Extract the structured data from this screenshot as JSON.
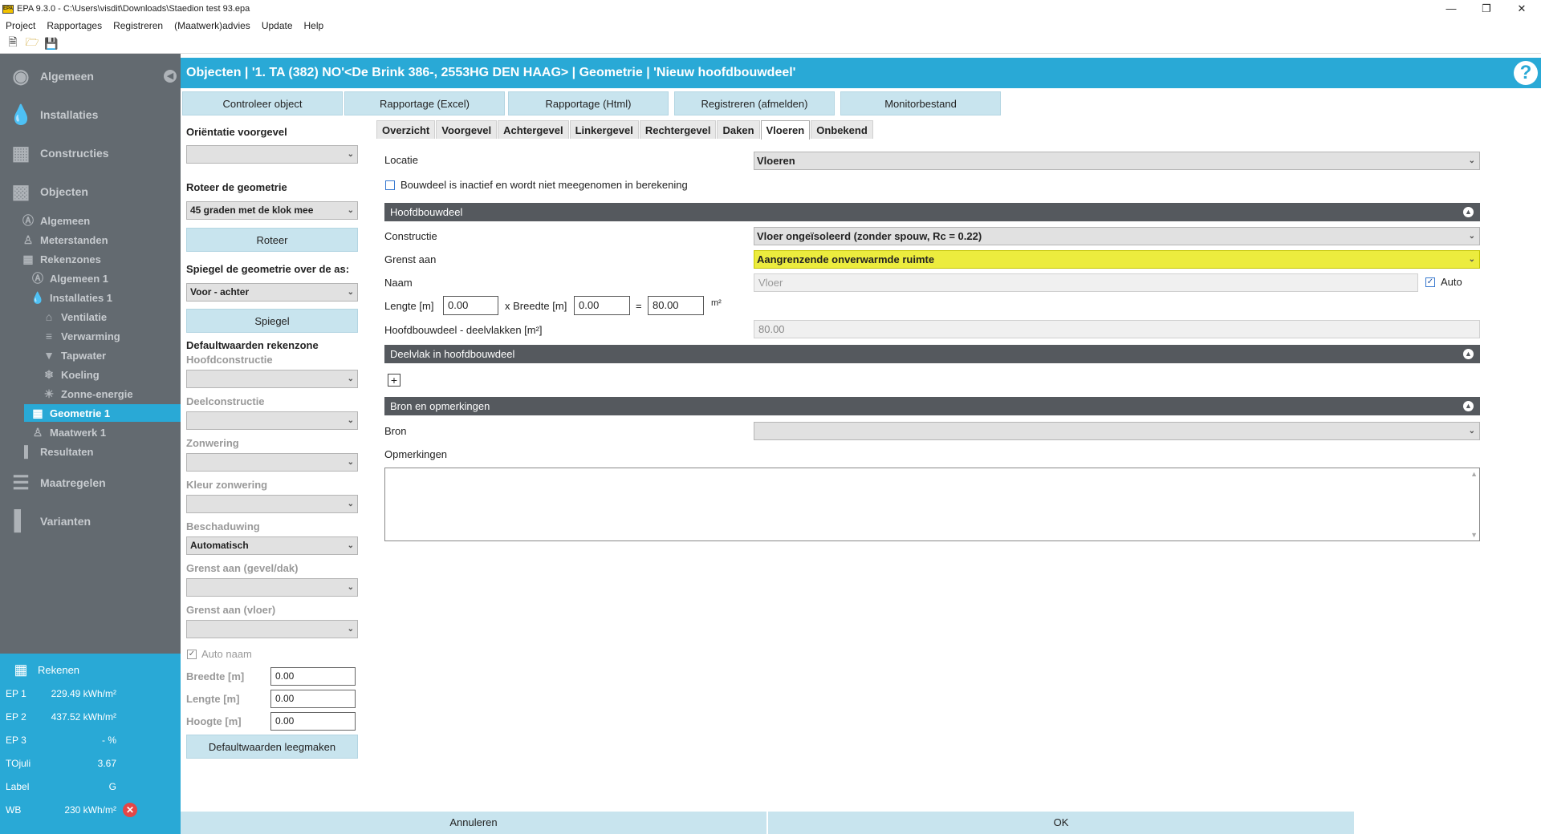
{
  "window": {
    "title": "EPA 9.3.0 - C:\\Users\\visdit\\Downloads\\Staedion test 93.epa",
    "app_icon": "EPA"
  },
  "menu": [
    "Project",
    "Rapportages",
    "Registreren",
    "(Maatwerk)advies",
    "Update",
    "Help"
  ],
  "sidebar": {
    "main": [
      {
        "label": "Algemeen",
        "icon": "flame-circle-icon"
      },
      {
        "label": "Installaties",
        "icon": "flame-icon"
      },
      {
        "label": "Constructies",
        "icon": "blocks-icon"
      },
      {
        "label": "Objecten",
        "icon": "building-icon"
      }
    ],
    "sub": [
      {
        "label": "Algemeen",
        "icon": "letter-a-icon"
      },
      {
        "label": "Meterstanden",
        "icon": "person-icon"
      },
      {
        "label": "Rekenzones",
        "icon": "grid-icon"
      },
      {
        "label": "Algemeen 1",
        "icon": "letter-a-icon"
      },
      {
        "label": "Installaties 1",
        "icon": "flame-icon"
      },
      {
        "label": "Ventilatie",
        "icon": "vent-icon"
      },
      {
        "label": "Verwarming",
        "icon": "thermometer-icon"
      },
      {
        "label": "Tapwater",
        "icon": "drop-icon"
      },
      {
        "label": "Koeling",
        "icon": "snowflake-icon"
      },
      {
        "label": "Zonne-energie",
        "icon": "sun-icon"
      },
      {
        "label": "Geometrie 1",
        "icon": "grid-icon"
      },
      {
        "label": "Maatwerk 1",
        "icon": "person-icon"
      },
      {
        "label": "Resultaten",
        "icon": "bar-chart-icon"
      }
    ],
    "extra": [
      {
        "label": "Maatregelen",
        "icon": "list-icon"
      },
      {
        "label": "Varianten",
        "icon": "bar-chart-icon"
      }
    ]
  },
  "calc": {
    "title": "Rekenen",
    "rows": [
      {
        "label": "EP 1",
        "value": "229.49 kWh/m²"
      },
      {
        "label": "EP 2",
        "value": "437.52 kWh/m²"
      },
      {
        "label": "EP 3",
        "value": "-  %"
      },
      {
        "label": "TOjuli",
        "value": "3.67"
      },
      {
        "label": "Label",
        "value": "G"
      },
      {
        "label": "WB",
        "value": "230 kWh/m²"
      }
    ]
  },
  "header": {
    "title": "Objecten | '1. TA (382) NO'<De Brink 386-, 2553HG DEN HAAG> | Geometrie | 'Nieuw hoofdbouwdeel'",
    "help": "?"
  },
  "top_buttons": [
    "Controleer object",
    "Rapportage (Excel)",
    "Rapportage (Html)",
    "Registreren (afmelden)",
    "Monitorbestand"
  ],
  "left": {
    "orientatie_label": "Oriëntatie voorgevel",
    "orientatie_value": "",
    "roteer_label": "Roteer de geometrie",
    "roteer_value": "45 graden met de klok mee",
    "roteer_btn": "Roteer",
    "spiegel_label": "Spiegel de geometrie over de as:",
    "spiegel_value": "Voor - achter",
    "spiegel_btn": "Spiegel",
    "default_label": "Defaultwaarden rekenzone",
    "hoofdconstructie": "Hoofdconstructie",
    "deelconstructie": "Deelconstructie",
    "zonwering": "Zonwering",
    "kleur_zonwering": "Kleur zonwering",
    "beschaduwing": "Beschaduwing",
    "beschaduwing_value": "Automatisch",
    "grenst_gevel": "Grenst aan (gevel/dak)",
    "grenst_vloer": "Grenst aan (vloer)",
    "auto_naam": "Auto naam",
    "breedte_label": "Breedte [m]",
    "breedte_value": "0.00",
    "lengte_label": "Lengte [m]",
    "lengte_value": "0.00",
    "hoogte_label": "Hoogte [m]",
    "hoogte_value": "0.00",
    "leegmaken_btn": "Defaultwaarden leegmaken"
  },
  "tabs": [
    "Overzicht",
    "Voorgevel",
    "Achtergevel",
    "Linkergevel",
    "Rechtergevel",
    "Daken",
    "Vloeren",
    "Onbekend"
  ],
  "active_tab": "Vloeren",
  "form": {
    "locatie_label": "Locatie",
    "locatie_value": "Vloeren",
    "inactief_label": "Bouwdeel is inactief en wordt niet meegenomen in berekening",
    "section_hoofd": "Hoofdbouwdeel",
    "constructie_label": "Constructie",
    "constructie_value": "Vloer ongeïsoleerd (zonder spouw, Rc = 0.22)",
    "grenst_label": "Grenst aan",
    "grenst_value": "Aangrenzende onverwarmde ruimte",
    "naam_label": "Naam",
    "naam_placeholder": "Vloer",
    "auto_label": "Auto",
    "lengte_label": "Lengte [m]",
    "lengte_value": "0.00",
    "breedte_label": "x Breedte [m]",
    "breedte_value": "0.00",
    "eq": "=",
    "area_value": "80.00",
    "area_unit": "m²",
    "deelvlak_label": "Hoofdbouwdeel - deelvlakken [m²]",
    "deelvlak_value": "80.00",
    "section_deel": "Deelvlak in hoofdbouwdeel",
    "add_symbol": "+",
    "section_bron": "Bron en opmerkingen",
    "bron_label": "Bron",
    "opmerkingen_label": "Opmerkingen"
  },
  "bottom": {
    "cancel": "Annuleren",
    "ok": "OK"
  },
  "colors": {
    "accent": "#29a9d6",
    "sidebar": "#636a70",
    "highlight": "#ecec3e",
    "section": "#55595e"
  }
}
